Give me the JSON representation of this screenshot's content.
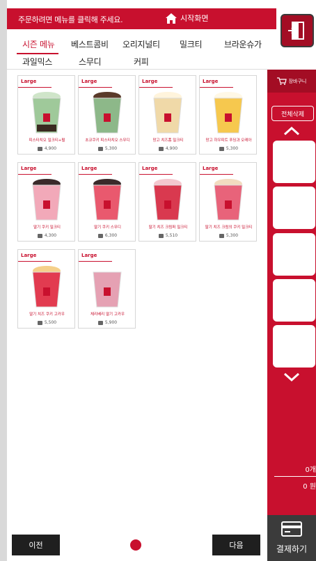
{
  "header": {
    "hint": "주문하려면 메뉴를 클릭해 주세요.",
    "home_label": "시작화면"
  },
  "categories": [
    "시즌 메뉴",
    "베스트콤비",
    "오리지널티",
    "밀크티",
    "브라운슈가",
    "과일믹스",
    "스무디",
    "커피"
  ],
  "active_category": "시즌 메뉴",
  "products": [
    {
      "size": "Large",
      "name": "피스타치오 밀크티+펄",
      "price": "4,900",
      "cup": "#9fc99a",
      "top": "#cfe5c9",
      "pearl": true
    },
    {
      "size": "Large",
      "name": "초코쿠키 피스타치오 스무디",
      "price": "5,300",
      "cup": "#8db889",
      "top": "#5a3a2a",
      "pearl": false
    },
    {
      "size": "Large",
      "name": "망고 치즈폼 밀크티",
      "price": "4,900",
      "cup": "#f0d9a8",
      "top": "#fff4dc",
      "pearl": false
    },
    {
      "size": "Large",
      "name": "망고 하우피트 푸딩과 오레아",
      "price": "5,300",
      "cup": "#f6c84e",
      "top": "#fff8e6",
      "pearl": false
    },
    {
      "size": "Large",
      "name": "딸기 쿠키 밀크티",
      "price": "4,300",
      "cup": "#f2a9b9",
      "top": "#3a2a2a",
      "pearl": false
    },
    {
      "size": "Large",
      "name": "딸기 쿠키 스무디",
      "price": "6,300",
      "cup": "#e9596e",
      "top": "#3a2a2a",
      "pearl": false
    },
    {
      "size": "Large",
      "name": "딸기 치즈 크림퍼 밀크티",
      "price": "5,510",
      "cup": "#d9394f",
      "top": "#f4c8cf",
      "pearl": false
    },
    {
      "size": "Large",
      "name": "딸기 치즈 크림의 쿠키 밀크티",
      "price": "5,300",
      "cup": "#e8637a",
      "top": "#f2dcc0",
      "pearl": false
    },
    {
      "size": "Large",
      "name": "딸기 치즈 쿠키 고카우",
      "price": "5,500",
      "cup": "#e23b50",
      "top": "#f5d08a",
      "pearl": false
    },
    {
      "size": "Large",
      "name": "체리베리 딸기 고카우",
      "price": "5,900",
      "cup": "#e5a1b3",
      "top": "#ffffff",
      "pearl": false
    }
  ],
  "cart": {
    "title": "장바구니",
    "clear_label": "전체삭제",
    "count": "0개",
    "total": "0 원"
  },
  "footer": {
    "prev_label": "이전",
    "next_label": "다음",
    "pay_label": "결제하기"
  },
  "colors": {
    "brand": "#c8102e",
    "dark": "#1f1f1f"
  }
}
